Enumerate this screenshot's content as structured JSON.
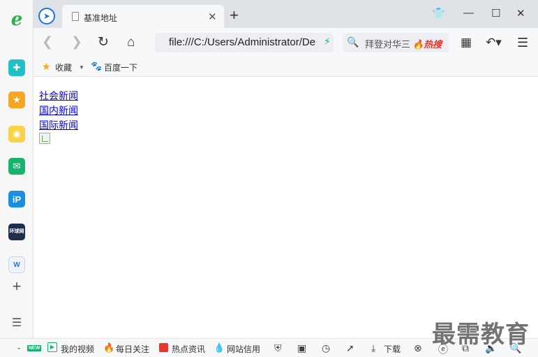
{
  "sidebar": {
    "items": [
      {
        "name": "browser-logo-icon",
        "glyph": "e"
      },
      {
        "name": "health-plus-icon",
        "glyph": "✚"
      },
      {
        "name": "favorites-star-icon",
        "glyph": "★"
      },
      {
        "name": "weibo-icon",
        "glyph": "◉"
      },
      {
        "name": "mail-icon",
        "glyph": "✉"
      },
      {
        "name": "ip-app-icon",
        "glyph": "iP"
      },
      {
        "name": "news-app-icon",
        "glyph": "环球网"
      },
      {
        "name": "word-doc-icon",
        "glyph": "W"
      },
      {
        "name": "add-app-icon",
        "glyph": "+"
      },
      {
        "name": "sidebar-menu-icon",
        "glyph": "☰"
      }
    ]
  },
  "tabbar": {
    "tab_title": "基准地址",
    "tab_close": "✕",
    "new_tab": "+",
    "shirt_icon": "👕",
    "minimize": "—",
    "maximize": "☐",
    "close": "✕"
  },
  "toolbar": {
    "back": "❮",
    "forward": "❯",
    "reload": "↻",
    "home": "⌂",
    "address_value": "file:///C:/Users/Administrator/Desktop",
    "search_text": "拜登对华三",
    "hot_label": "🔥热搜",
    "grid": "▦",
    "undo": "↶▾",
    "menu": "☰"
  },
  "bookmarks": {
    "favorites": "收藏",
    "baidu": "百度一下"
  },
  "content": {
    "links": [
      "社会新闻",
      "国内新闻",
      "国际新闻"
    ]
  },
  "statusbar": {
    "new_badge": "NEW",
    "my_video": "我的视频",
    "daily_follow": "每日关注",
    "hot_news": "热点资讯",
    "site_credit": "网站信用",
    "download": "下载"
  },
  "watermark": "最需教育",
  "colors": {
    "link": "#0000ee",
    "accent_green": "#16b36d",
    "tabbar_bg": "#dfe3e8"
  }
}
